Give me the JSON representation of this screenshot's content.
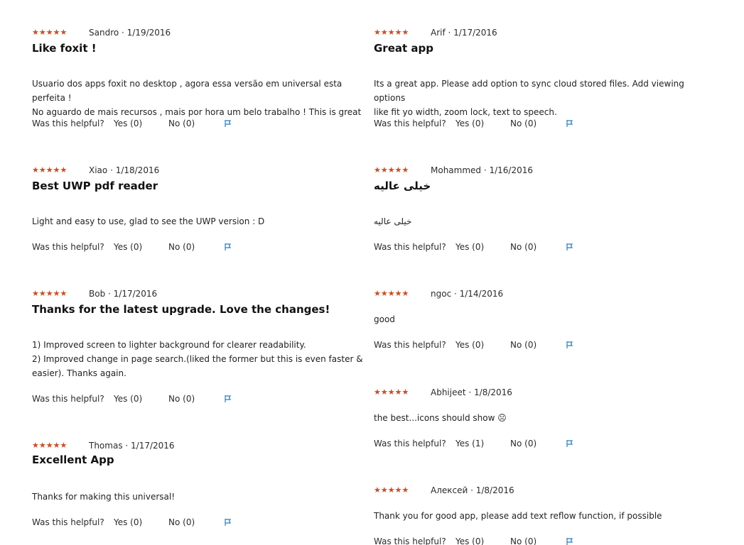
{
  "helpful": {
    "label": "Was this helpful?"
  },
  "colors": {
    "star": "#cf4a1c",
    "flag": "#2e7bb4"
  },
  "left_reviews": [
    {
      "stars": "★★★★★",
      "author_date": "Sandro · 1/19/2016",
      "title": "Like foxit !",
      "body": [
        "Usuario dos apps foxit no desktop , agora essa versão em universal esta perfeita !",
        "No aguardo de mais recursos , mais por hora um belo trabalho ! This is great"
      ],
      "yes": "Yes (0)",
      "no": "No (0)"
    },
    {
      "stars": "★★★★★",
      "author_date": "Xiao · 1/18/2016",
      "title": "Best UWP pdf reader",
      "body": [
        "Light and easy to use, glad to see the UWP version : D"
      ],
      "yes": "Yes (0)",
      "no": "No (0)"
    },
    {
      "stars": "★★★★★",
      "author_date": "Bob · 1/17/2016",
      "title": "Thanks for the latest upgrade. Love the changes!",
      "body": [
        "1) Improved screen to lighter background for clearer readability.",
        "2) Improved change in page search.(liked the former but this is even faster &",
        "easier). Thanks again."
      ],
      "yes": "Yes (0)",
      "no": "No (0)"
    },
    {
      "stars": "★★★★★",
      "author_date": "Thomas · 1/17/2016",
      "title": "Excellent App",
      "body": [
        "Thanks for making this universal!"
      ],
      "yes": "Yes (0)",
      "no": "No (0)"
    }
  ],
  "right_reviews": [
    {
      "stars": "★★★★★",
      "author_date": "Arif · 1/17/2016",
      "title": "Great app",
      "body": [
        "Its a great app. Please add option to sync cloud stored files. Add viewing options",
        "like fit yo width, zoom lock, text to speech."
      ],
      "yes": "Yes (0)",
      "no": "No (0)"
    },
    {
      "stars": "★★★★★",
      "author_date": "Mohammed · 1/16/2016",
      "title": "خیلی عالیه",
      "body": [
        "خیلی عالیه"
      ],
      "yes": "Yes (0)",
      "no": "No (0)"
    },
    {
      "stars": "★★★★★",
      "author_date": "ngoc · 1/14/2016",
      "title": "",
      "body": [
        "good"
      ],
      "yes": "Yes (0)",
      "no": "No (0)"
    },
    {
      "stars": "★★★★★",
      "author_date": "Abhijeet · 1/8/2016",
      "title": "",
      "body": [
        "the best...icons should show ☹"
      ],
      "yes": "Yes (1)",
      "no": "No (0)"
    },
    {
      "stars": "★★★★★",
      "author_date": "Алексей · 1/8/2016",
      "title": "",
      "body": [
        "Thank you for good app, please add text reflow function, if possible"
      ],
      "yes": "Yes (0)",
      "no": "No (0)"
    }
  ]
}
